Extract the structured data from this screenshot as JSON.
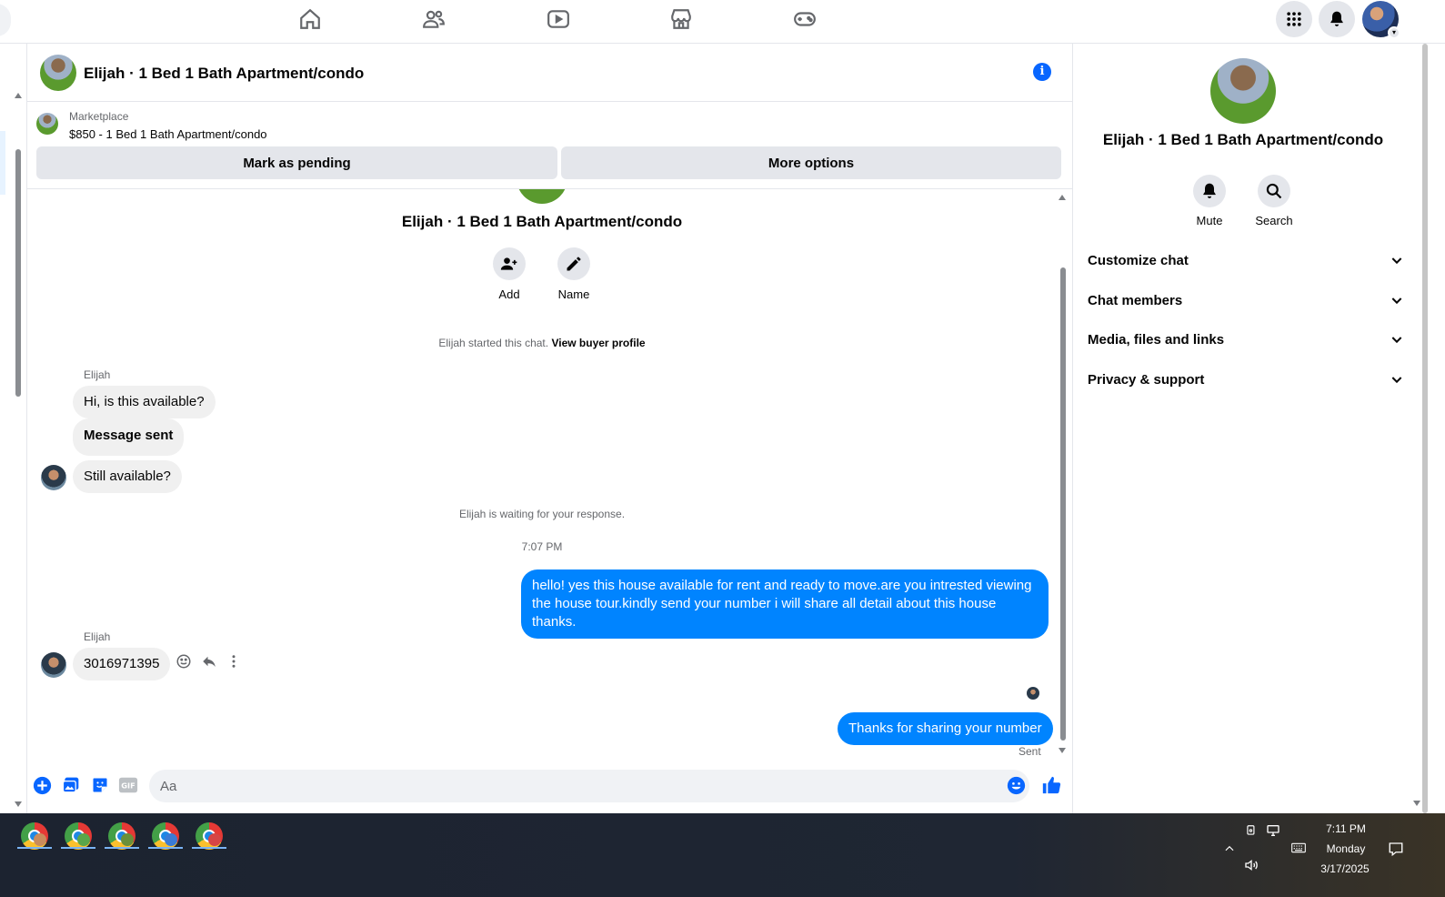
{
  "chat": {
    "title": "Elijah · 1 Bed 1 Bath Apartment/condo",
    "marketplace_label": "Marketplace",
    "listing": "$850 - 1 Bed 1 Bath Apartment/condo",
    "mark_pending": "Mark as pending",
    "more_options": "More options",
    "intro_title": "Elijah · 1 Bed 1 Bath Apartment/condo",
    "add_label": "Add",
    "name_label": "Name",
    "started_text": "Elijah started this chat.",
    "view_profile": "View buyer profile",
    "sender_name": "Elijah",
    "msg1": "Hi, is this available?",
    "msg2": "Message sent",
    "msg3": "Still available?",
    "waiting": "Elijah is waiting for your response.",
    "time": "7:07 PM",
    "reply1": "hello! yes this house available for rent and ready to move.are you intrested viewing the house tour.kindly send your number i will share all detail about this house thanks.",
    "sender_name2": "Elijah",
    "msg4": "3016971395",
    "reply2": "Thanks for sharing your number",
    "sent_status": "Sent",
    "input_placeholder": "Aa"
  },
  "rpanel": {
    "title": "Elijah · 1 Bed 1 Bath Apartment/condo",
    "mute": "Mute",
    "search": "Search",
    "rows": [
      "Customize chat",
      "Chat members",
      "Media, files and links",
      "Privacy & support"
    ]
  },
  "taskbar": {
    "time": "7:11 PM",
    "day": "Monday",
    "date": "3/17/2025"
  },
  "colors": {
    "accent": "#0866ff",
    "bubble_me": "#0084ff",
    "bubble_other": "#f0f0f0"
  }
}
